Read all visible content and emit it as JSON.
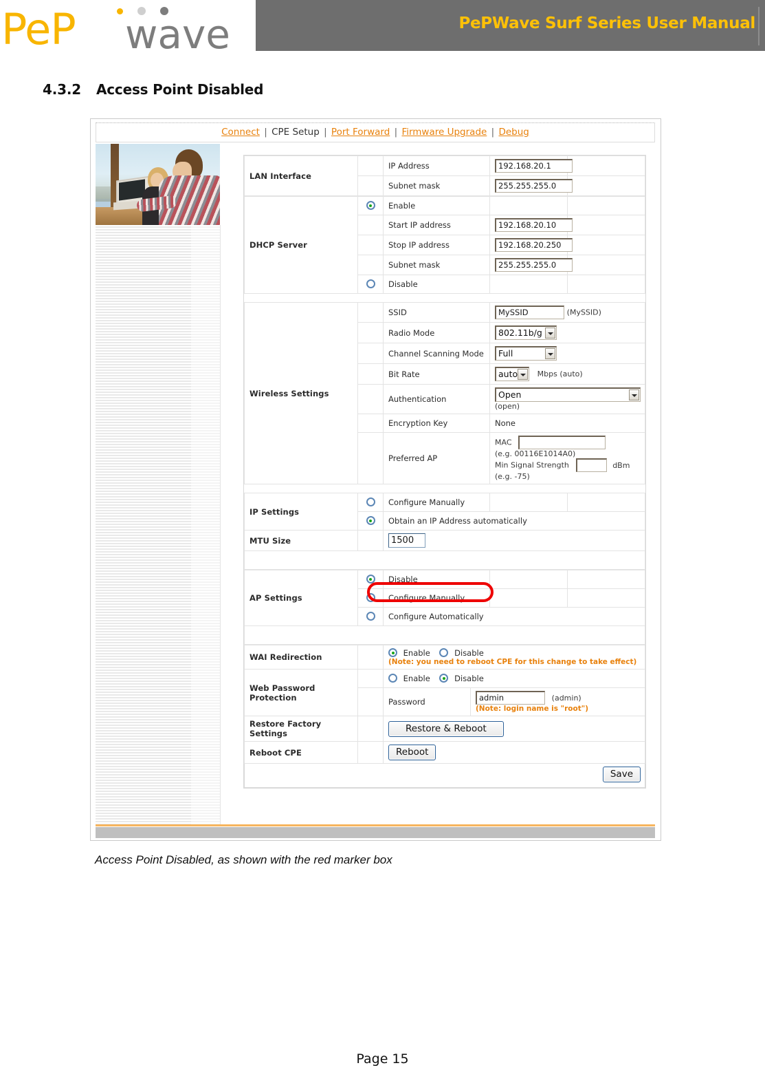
{
  "document": {
    "header_title": "PePWave Surf Series User Manual",
    "logo_pep": "PeP",
    "logo_wave": "wave",
    "section_number": "4.3.2",
    "section_title": "Access Point Disabled",
    "caption": "Access Point Disabled, as shown with the red marker box",
    "page_footer": "Page 15"
  },
  "colors": {
    "brand_yellow": "#f8b500",
    "brand_gray": "#6e6e6e",
    "link_orange": "#e8810c",
    "marker_red": "#ee0000",
    "radio_green": "#19a519",
    "radio_blue": "#5b86b5"
  },
  "screenshot": {
    "nav": {
      "items": [
        {
          "label": "Connect",
          "link": true
        },
        {
          "label": "CPE Setup",
          "link": false
        },
        {
          "label": "Port Forward",
          "link": true
        },
        {
          "label": "Firmware Upgrade",
          "link": true
        },
        {
          "label": "Debug",
          "link": true
        }
      ],
      "separator": "|"
    },
    "lan_interface": {
      "label": "LAN Interface",
      "rows": [
        {
          "name": "IP Address",
          "value": "192.168.20.1"
        },
        {
          "name": "Subnet mask",
          "value": "255.255.255.0"
        }
      ]
    },
    "dhcp_server": {
      "label": "DHCP Server",
      "enable_label": "Enable",
      "enable_selected": true,
      "disable_label": "Disable",
      "disable_selected": false,
      "rows": [
        {
          "name": "Start IP address",
          "value": "192.168.20.10"
        },
        {
          "name": "Stop IP address",
          "value": "192.168.20.250"
        },
        {
          "name": "Subnet mask",
          "value": "255.255.255.0"
        }
      ]
    },
    "wireless_settings": {
      "label": "Wireless Settings",
      "ssid": {
        "name": "SSID",
        "value": "MySSID",
        "hint": "(MySSID)"
      },
      "radio_mode": {
        "name": "Radio Mode",
        "value": "802.11b/g"
      },
      "channel_scanning_mode": {
        "name": "Channel Scanning Mode",
        "value": "Full"
      },
      "bit_rate": {
        "name": "Bit Rate",
        "value": "auto",
        "suffix": "Mbps (auto)"
      },
      "authentication": {
        "name": "Authentication",
        "value": "Open",
        "hint": "(open)"
      },
      "encryption_key": {
        "name": "Encryption Key",
        "value": "None"
      },
      "preferred_ap": {
        "name": "Preferred AP",
        "mac_label": "MAC",
        "mac_value": "",
        "mac_hint": "(e.g. 00116E1014A0)",
        "signal_label": "Min Signal Strength",
        "signal_value": "",
        "signal_unit": "dBm",
        "signal_hint": "(e.g. -75)"
      }
    },
    "ip_settings": {
      "label": "IP Settings",
      "manual_label": "Configure Manually",
      "manual_selected": false,
      "auto_label": "Obtain an IP Address automatically",
      "auto_selected": true
    },
    "mtu_size": {
      "label": "MTU Size",
      "value": "1500"
    },
    "ap_settings": {
      "label": "AP Settings",
      "options": [
        {
          "label": "Disable",
          "selected": true,
          "highlighted": true
        },
        {
          "label": "Configure Manually",
          "selected": false,
          "highlighted": false
        },
        {
          "label": "Configure Automatically",
          "selected": false,
          "highlighted": false
        }
      ]
    },
    "wai_redirection": {
      "label": "WAI Redirection",
      "enable_label": "Enable",
      "enable_selected": true,
      "disable_label": "Disable",
      "disable_selected": false,
      "note": "(Note: you need to reboot CPE for this change to take effect)"
    },
    "web_password_protection": {
      "label": "Web Password Protection",
      "enable_label": "Enable",
      "enable_selected": false,
      "disable_label": "Disable",
      "disable_selected": true,
      "password_label": "Password",
      "password_value": "admin",
      "password_hint": "(admin)",
      "note": "(Note: login name is \"root\")"
    },
    "restore_factory_settings": {
      "label": "Restore Factory Settings",
      "button": "Restore & Reboot"
    },
    "reboot_cpe": {
      "label": "Reboot CPE",
      "button": "Reboot"
    },
    "save_button": "Save"
  }
}
